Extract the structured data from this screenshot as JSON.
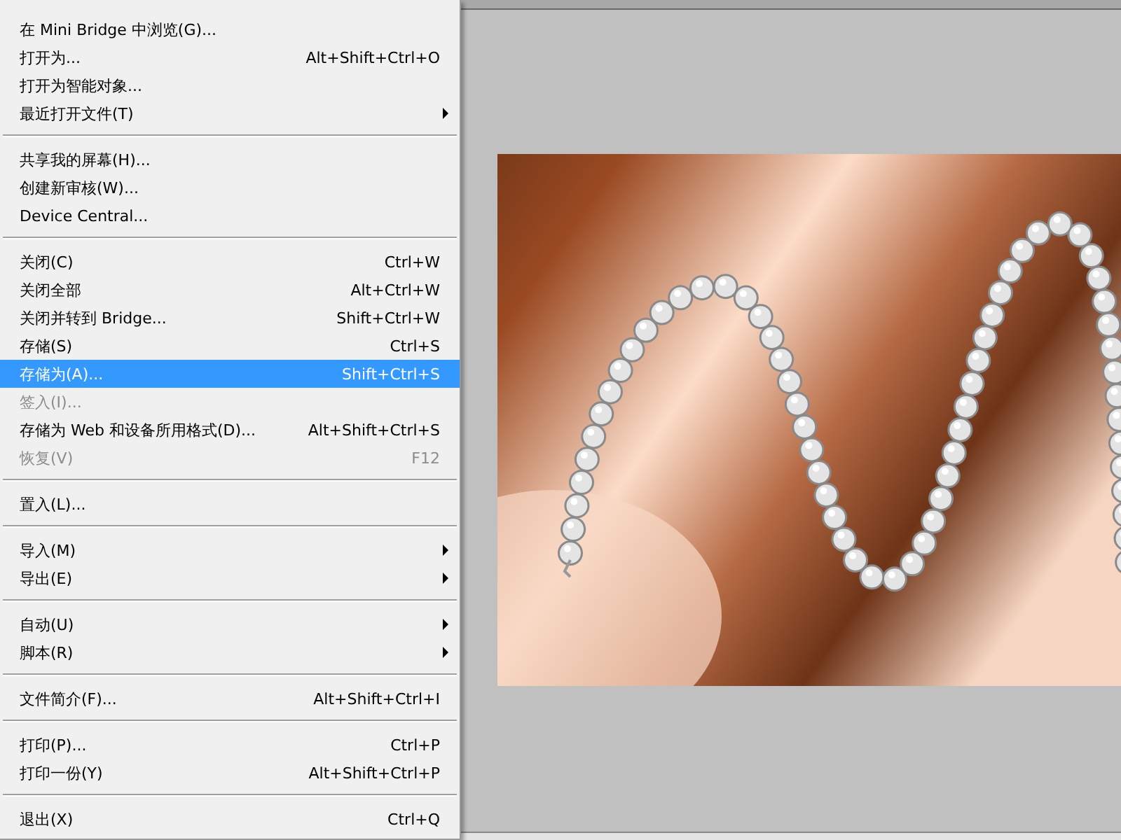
{
  "menu": {
    "items": [
      {
        "kind": "item",
        "label": "在 Mini Bridge 中浏览(G)...",
        "submenu": false,
        "disabled": false,
        "selected": false
      },
      {
        "kind": "item",
        "label": "打开为...",
        "shortcut": "Alt+Shift+Ctrl+O",
        "submenu": false,
        "disabled": false,
        "selected": false
      },
      {
        "kind": "item",
        "label": "打开为智能对象...",
        "submenu": false,
        "disabled": false,
        "selected": false
      },
      {
        "kind": "item",
        "label": "最近打开文件(T)",
        "submenu": true,
        "disabled": false,
        "selected": false
      },
      {
        "kind": "separator"
      },
      {
        "kind": "item",
        "label": "共享我的屏幕(H)...",
        "submenu": false,
        "disabled": false,
        "selected": false
      },
      {
        "kind": "item",
        "label": "创建新审核(W)...",
        "submenu": false,
        "disabled": false,
        "selected": false
      },
      {
        "kind": "item",
        "label": "Device Central...",
        "submenu": false,
        "disabled": false,
        "selected": false
      },
      {
        "kind": "separator"
      },
      {
        "kind": "item",
        "label": "关闭(C)",
        "shortcut": "Ctrl+W",
        "submenu": false,
        "disabled": false,
        "selected": false
      },
      {
        "kind": "item",
        "label": "关闭全部",
        "shortcut": "Alt+Ctrl+W",
        "submenu": false,
        "disabled": false,
        "selected": false
      },
      {
        "kind": "item",
        "label": "关闭并转到 Bridge...",
        "shortcut": "Shift+Ctrl+W",
        "submenu": false,
        "disabled": false,
        "selected": false
      },
      {
        "kind": "item",
        "label": "存储(S)",
        "shortcut": "Ctrl+S",
        "submenu": false,
        "disabled": false,
        "selected": false
      },
      {
        "kind": "item",
        "label": "存储为(A)...",
        "shortcut": "Shift+Ctrl+S",
        "submenu": false,
        "disabled": false,
        "selected": true
      },
      {
        "kind": "item",
        "label": "签入(I)...",
        "submenu": false,
        "disabled": true,
        "selected": false
      },
      {
        "kind": "item",
        "label": "存储为 Web 和设备所用格式(D)...",
        "shortcut": "Alt+Shift+Ctrl+S",
        "submenu": false,
        "disabled": false,
        "selected": false
      },
      {
        "kind": "item",
        "label": "恢复(V)",
        "shortcut": "F12",
        "submenu": false,
        "disabled": true,
        "selected": false
      },
      {
        "kind": "separator"
      },
      {
        "kind": "item",
        "label": "置入(L)...",
        "submenu": false,
        "disabled": false,
        "selected": false
      },
      {
        "kind": "separator"
      },
      {
        "kind": "item",
        "label": "导入(M)",
        "submenu": true,
        "disabled": false,
        "selected": false
      },
      {
        "kind": "item",
        "label": "导出(E)",
        "submenu": true,
        "disabled": false,
        "selected": false
      },
      {
        "kind": "separator"
      },
      {
        "kind": "item",
        "label": "自动(U)",
        "submenu": true,
        "disabled": false,
        "selected": false
      },
      {
        "kind": "item",
        "label": "脚本(R)",
        "submenu": true,
        "disabled": false,
        "selected": false
      },
      {
        "kind": "separator"
      },
      {
        "kind": "item",
        "label": "文件简介(F)...",
        "shortcut": "Alt+Shift+Ctrl+I",
        "submenu": false,
        "disabled": false,
        "selected": false
      },
      {
        "kind": "separator"
      },
      {
        "kind": "item",
        "label": "打印(P)...",
        "shortcut": "Ctrl+P",
        "submenu": false,
        "disabled": false,
        "selected": false
      },
      {
        "kind": "item",
        "label": "打印一份(Y)",
        "shortcut": "Alt+Shift+Ctrl+P",
        "submenu": false,
        "disabled": false,
        "selected": false
      },
      {
        "kind": "separator"
      },
      {
        "kind": "item",
        "label": "退出(X)",
        "shortcut": "Ctrl+Q",
        "submenu": false,
        "disabled": false,
        "selected": false
      }
    ]
  }
}
